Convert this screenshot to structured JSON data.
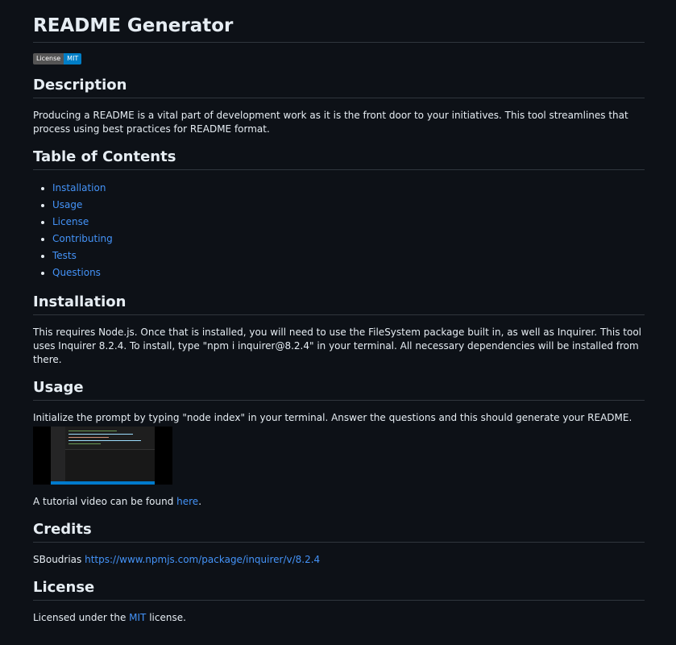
{
  "title": "README Generator",
  "badge": {
    "left": "License",
    "right": "MIT"
  },
  "description": {
    "heading": "Description",
    "text": "Producing a README is a vital part of development work as it is the front door to your initiatives. This tool streamlines that process using best practices for README format."
  },
  "toc": {
    "heading": "Table of Contents",
    "items": [
      "Installation",
      "Usage",
      "License",
      "Contributing",
      "Tests",
      "Questions"
    ]
  },
  "installation": {
    "heading": "Installation",
    "text": "This requires Node.js. Once that is installed, you will need to use the FileSystem package built in, as well as Inquirer. This tool uses Inquirer 8.2.4. To install, type \"npm i inquirer@8.2.4\" in your terminal. All necessary dependencies will be installed from there."
  },
  "usage": {
    "heading": "Usage",
    "text": "Initialize the prompt by typing \"node index\" in your terminal. Answer the questions and this should generate your README.",
    "tutorial_prefix": "A tutorial video can be found ",
    "tutorial_link": "here",
    "tutorial_suffix": "."
  },
  "credits": {
    "heading": "Credits",
    "name": "SBoudrias",
    "link": "https://www.npmjs.com/package/inquirer/v/8.2.4"
  },
  "license": {
    "heading": "License",
    "prefix": "Licensed under the ",
    "link": "MIT",
    "suffix": " license."
  },
  "colors": {
    "background": "#0d1117",
    "link": "#4493f8",
    "badge_right": "#007ec6"
  }
}
